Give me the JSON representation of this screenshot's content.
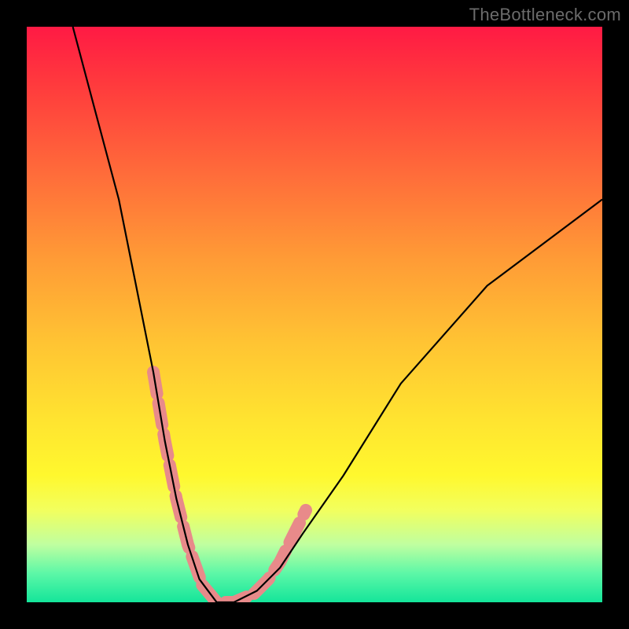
{
  "watermark": "TheBottleneck.com",
  "chart_data": {
    "type": "line",
    "title": "",
    "xlabel": "",
    "ylabel": "",
    "xlim": [
      0,
      100
    ],
    "ylim": [
      0,
      100
    ],
    "legend": false,
    "grid": false,
    "background_gradient": [
      "#ff1a44",
      "#ffe330",
      "#14e59a"
    ],
    "series": [
      {
        "name": "bottleneck-curve",
        "color": "#000000",
        "x": [
          8,
          12,
          16,
          19,
          22,
          24,
          26,
          28,
          30,
          33,
          36,
          40,
          44,
          48,
          55,
          65,
          80,
          100
        ],
        "y": [
          100,
          85,
          70,
          55,
          40,
          28,
          18,
          10,
          4,
          0,
          0,
          2,
          6,
          12,
          22,
          38,
          55,
          70
        ]
      }
    ],
    "highlight_segments": [
      {
        "name": "left-descent-highlight",
        "color": "#e88a8a",
        "width": 16,
        "x": [
          22,
          24,
          26,
          28,
          30.5
        ],
        "y": [
          40,
          28,
          18,
          10,
          3
        ]
      },
      {
        "name": "valley-highlight",
        "color": "#e88a8a",
        "width": 16,
        "x": [
          30.5,
          33,
          36,
          39.5
        ],
        "y": [
          3,
          0,
          0,
          1.5
        ]
      },
      {
        "name": "right-ascent-highlight",
        "color": "#e88a8a",
        "width": 16,
        "x": [
          39.5,
          42,
          44,
          46,
          48.5
        ],
        "y": [
          1.5,
          4,
          7,
          11,
          16
        ]
      }
    ]
  }
}
